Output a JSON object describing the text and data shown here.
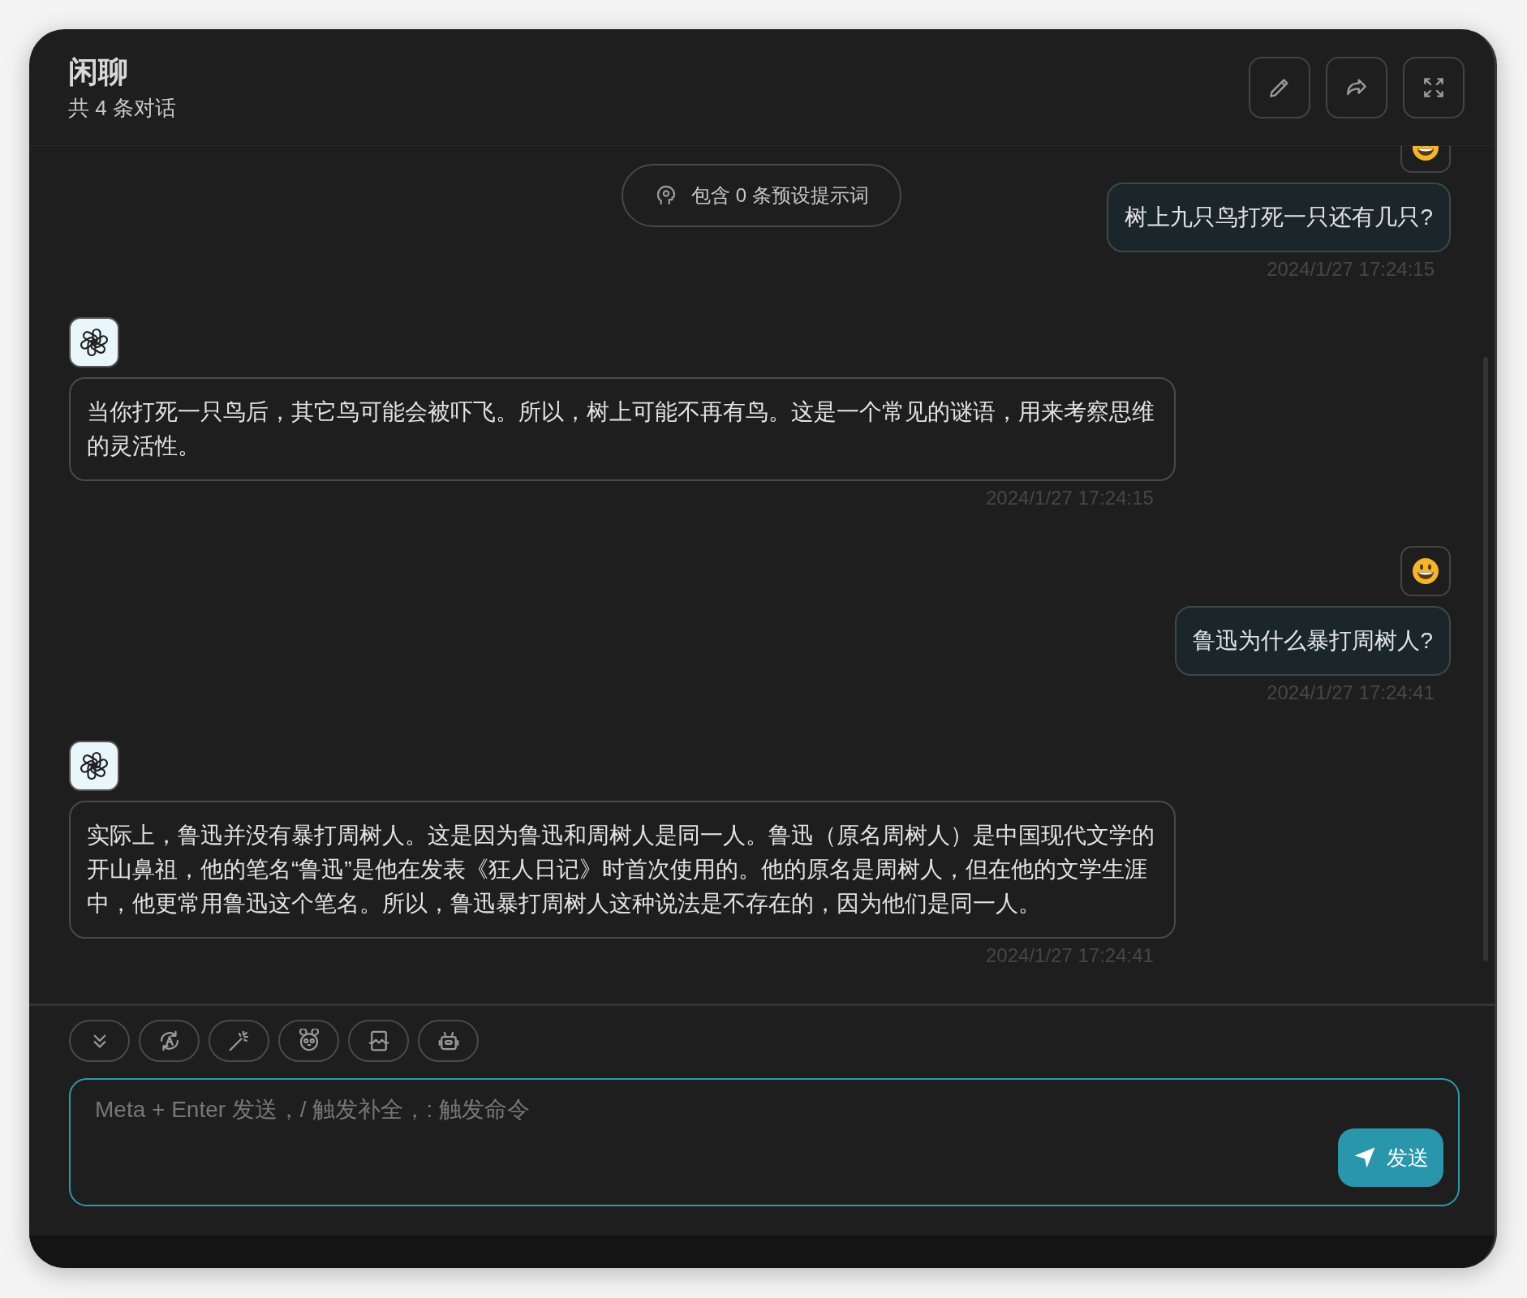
{
  "header": {
    "title": "闲聊",
    "subtitle": "共 4 条对话"
  },
  "prompt_notice": {
    "text": "包含 0 条预设提示词"
  },
  "messages": [
    {
      "kind": "user",
      "text": "树上九只鸟打死一只还有几只?",
      "time": "2024/1/27 17:24:15"
    },
    {
      "kind": "assistant",
      "text": "当你打死一只鸟后，其它鸟可能会被吓飞。所以，树上可能不再有鸟。这是一个常见的谜语，用来考察思维的灵活性。",
      "time": "2024/1/27 17:24:15"
    },
    {
      "kind": "user",
      "text": "鲁迅为什么暴打周树人?",
      "time": "2024/1/27 17:24:41"
    },
    {
      "kind": "assistant",
      "text": "实际上，鲁迅并没有暴打周树人。这是因为鲁迅和周树人是同一人。鲁迅（原名周树人）是中国现代文学的开山鼻祖，他的笔名“鲁迅”是他在发表《狂人日记》时首次使用的。他的原名是周树人，但在他的文学生涯中，他更常用鲁迅这个笔名。所以，鲁迅暴打周树人这种说法是不存在的，因为他们是同一人。",
      "time": "2024/1/27 17:24:41"
    }
  ],
  "composer": {
    "placeholder": "Meta + Enter 发送，/ 触发补全，: 触发命令",
    "send_label": "发送"
  }
}
